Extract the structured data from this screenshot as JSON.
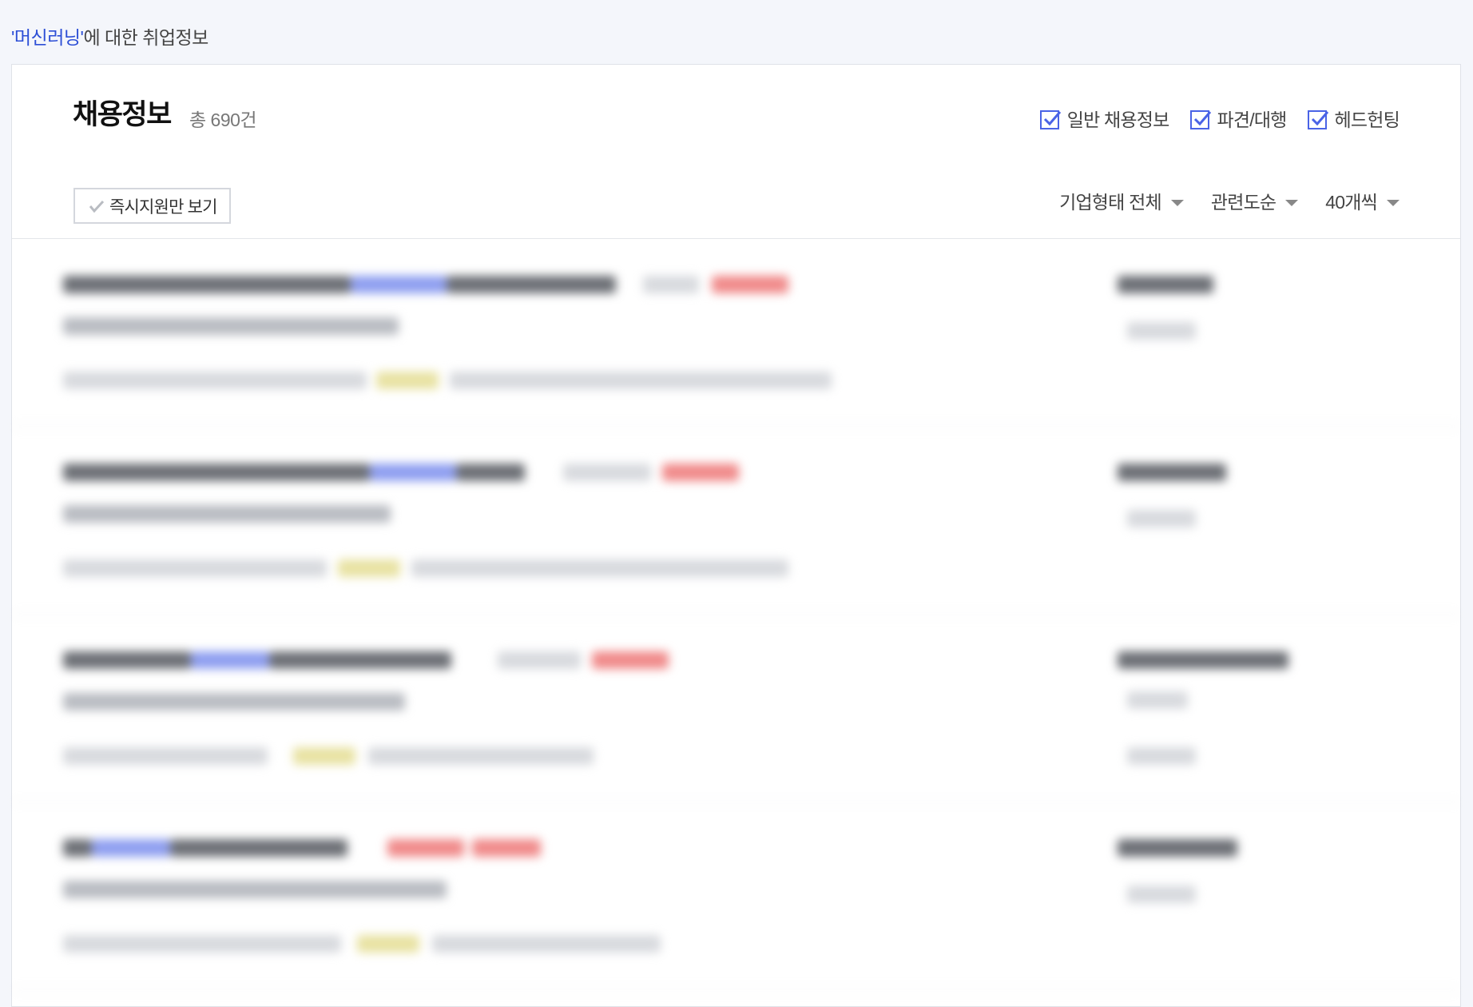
{
  "search": {
    "keyword": "'머신러닝'",
    "suffix": "에 대한 취업정보"
  },
  "header": {
    "title": "채용정보",
    "count": "총 690건"
  },
  "filters": [
    {
      "label": "일반 채용정보",
      "checked": true
    },
    {
      "label": "파견/대행",
      "checked": true
    },
    {
      "label": "헤드헌팅",
      "checked": true
    }
  ],
  "instant_apply": {
    "label": "즉시지원만 보기"
  },
  "sort_options": [
    {
      "label": "기업형태 전체"
    },
    {
      "label": "관련도순"
    },
    {
      "label": "40개씩"
    }
  ],
  "colors": {
    "accent": "#4a63e6",
    "keyword": "#2d4fd6"
  },
  "icons": {
    "checkbox": "checkbox-checked-icon",
    "dropdown": "caret-down-icon",
    "check": "check-icon"
  }
}
